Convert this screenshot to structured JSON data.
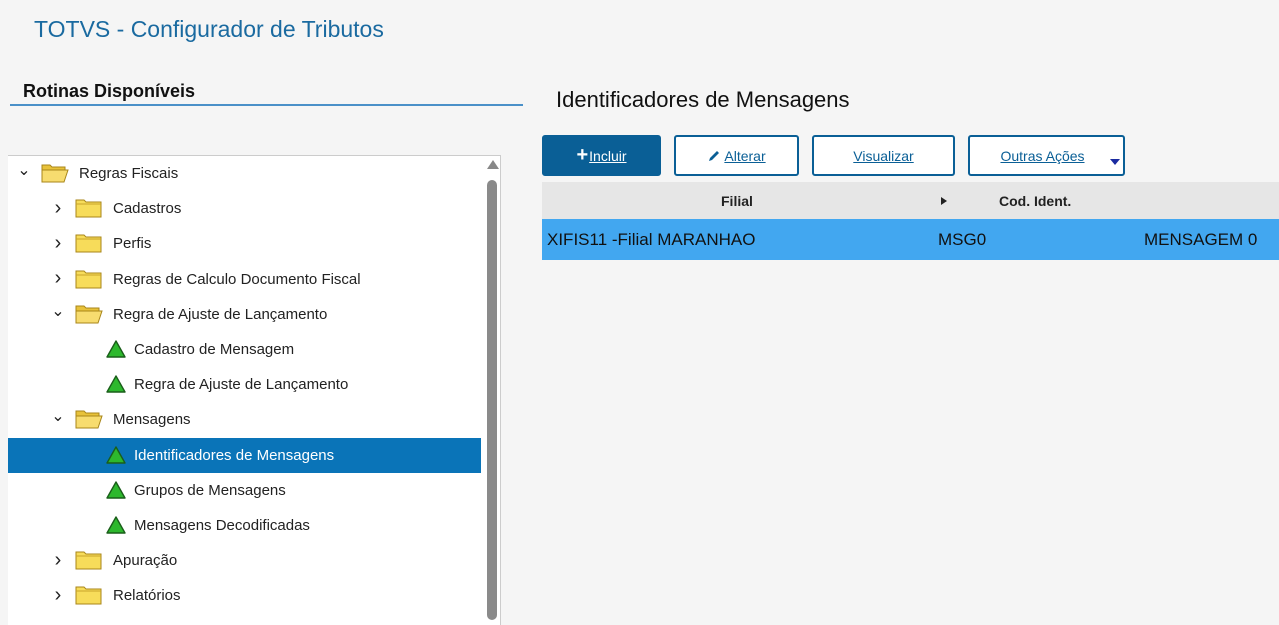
{
  "app": {
    "title": "TOTVS - Configurador de Tributos"
  },
  "left": {
    "header": "Rotinas Disponíveis"
  },
  "tree": {
    "items": [
      {
        "label": "Regras Fiscais",
        "kind": "folder-open",
        "expanded": true
      },
      {
        "label": "Cadastros",
        "kind": "folder",
        "expanded": false
      },
      {
        "label": "Perfis",
        "kind": "folder",
        "expanded": false
      },
      {
        "label": "Regras de Calculo Documento Fiscal",
        "kind": "folder",
        "expanded": false
      },
      {
        "label": "Regra de Ajuste de Lançamento",
        "kind": "folder-open",
        "expanded": true
      },
      {
        "label": "Cadastro de Mensagem",
        "kind": "routine"
      },
      {
        "label": "Regra de Ajuste de Lançamento",
        "kind": "routine"
      },
      {
        "label": "Mensagens",
        "kind": "folder-open",
        "expanded": true
      },
      {
        "label": "Identificadores de Mensagens",
        "kind": "routine",
        "selected": true
      },
      {
        "label": "Grupos de Mensagens",
        "kind": "routine"
      },
      {
        "label": "Mensagens Decodificadas",
        "kind": "routine"
      },
      {
        "label": "Apuração",
        "kind": "folder",
        "expanded": false
      },
      {
        "label": "Relatórios",
        "kind": "folder",
        "expanded": false
      }
    ]
  },
  "main": {
    "title": "Identificadores de Mensagens",
    "buttons": {
      "incluir": "Incluir",
      "alterar": "Alterar",
      "visualizar": "Visualizar",
      "outras": "Outras Ações"
    },
    "grid": {
      "columns": [
        "Filial",
        "Cod. Ident."
      ],
      "rows": [
        {
          "filial": "XIFIS11 -Filial MARANHAO",
          "cod": "MSG0",
          "desc": "MENSAGEM 0"
        }
      ]
    }
  },
  "colors": {
    "accent": "#0a5f96",
    "selected_tree": "#0a74b8",
    "selected_row": "#42a7f0",
    "title": "#1a6aa0"
  },
  "icons": {
    "folder": "folder-icon",
    "routine": "green-triangle-icon",
    "expand": "chevron-right-icon",
    "collapse": "chevron-down-icon"
  }
}
